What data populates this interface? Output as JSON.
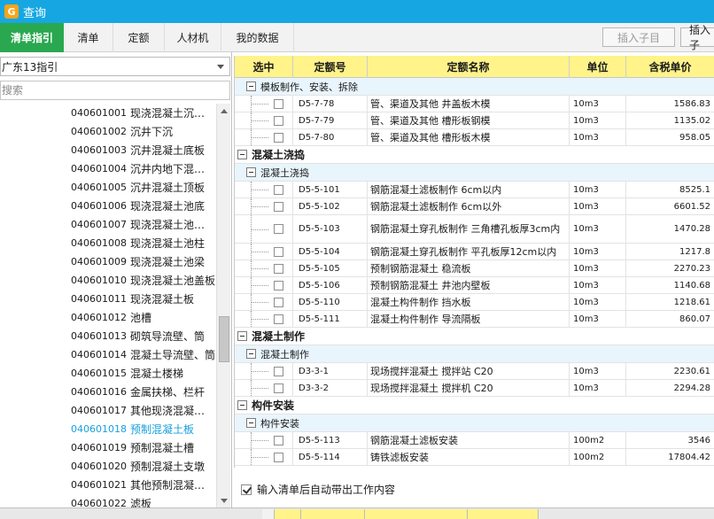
{
  "window": {
    "title": "查询"
  },
  "tabs": [
    {
      "label": "清单指引",
      "active": true
    },
    {
      "label": "清单",
      "active": false
    },
    {
      "label": "定额",
      "active": false
    },
    {
      "label": "人材机",
      "active": false
    },
    {
      "label": "我的数据",
      "active": false
    }
  ],
  "toolbar": {
    "insert_child_label": "插入子目",
    "insert_label": "插入子"
  },
  "left": {
    "combo_value": "广东13指引",
    "search_placeholder": "搜索",
    "items": [
      {
        "code": "040601001",
        "name": "现浇混凝土沉…"
      },
      {
        "code": "040601002",
        "name": "沉井下沉"
      },
      {
        "code": "040601003",
        "name": "沉井混凝土底板"
      },
      {
        "code": "040601004",
        "name": "沉井内地下混…"
      },
      {
        "code": "040601005",
        "name": "沉井混凝土顶板"
      },
      {
        "code": "040601006",
        "name": "现浇混凝土池底"
      },
      {
        "code": "040601007",
        "name": "现浇混凝土池…"
      },
      {
        "code": "040601008",
        "name": "现浇混凝土池柱"
      },
      {
        "code": "040601009",
        "name": "现浇混凝土池梁"
      },
      {
        "code": "040601010",
        "name": "现浇混凝土池盖板"
      },
      {
        "code": "040601011",
        "name": "现浇混凝土板"
      },
      {
        "code": "040601012",
        "name": "池槽"
      },
      {
        "code": "040601013",
        "name": "砌筑导流壁、筒"
      },
      {
        "code": "040601014",
        "name": "混凝土导流壁、筒"
      },
      {
        "code": "040601015",
        "name": "混凝土楼梯"
      },
      {
        "code": "040601016",
        "name": "金属扶梯、栏杆"
      },
      {
        "code": "040601017",
        "name": "其他现浇混凝…"
      },
      {
        "code": "040601018",
        "name": "预制混凝土板",
        "selected": true
      },
      {
        "code": "040601019",
        "name": "预制混凝土槽"
      },
      {
        "code": "040601020",
        "name": "预制混凝土支墩"
      },
      {
        "code": "040601021",
        "name": "其他预制混凝…"
      },
      {
        "code": "040601022",
        "name": "滤板"
      }
    ]
  },
  "grid": {
    "columns": [
      "选中",
      "定额号",
      "定额名称",
      "单位",
      "含税单价"
    ],
    "rows": [
      {
        "type": "group2",
        "label": "模板制作、安装、拆除"
      },
      {
        "type": "item",
        "code": "D5-7-78",
        "name": "管、渠道及其他 井盖板木模",
        "unit": "10m3",
        "price": "1586.83"
      },
      {
        "type": "item",
        "code": "D5-7-79",
        "name": "管、渠道及其他 槽形板钢模",
        "unit": "10m3",
        "price": "1135.02"
      },
      {
        "type": "item",
        "code": "D5-7-80",
        "name": "管、渠道及其他 槽形板木模",
        "unit": "10m3",
        "price": "958.05"
      },
      {
        "type": "group1",
        "label": "混凝土浇捣"
      },
      {
        "type": "group2",
        "label": "混凝土浇捣"
      },
      {
        "type": "item",
        "code": "D5-5-101",
        "name": "钢筋混凝土滤板制作 6cm以内",
        "unit": "10m3",
        "price": "8525.1"
      },
      {
        "type": "item",
        "code": "D5-5-102",
        "name": "钢筋混凝土滤板制作 6cm以外",
        "unit": "10m3",
        "price": "6601.52"
      },
      {
        "type": "item",
        "code": "D5-5-103",
        "name": "钢筋混凝土穿孔板制作 三角槽孔板厚3cm内",
        "unit": "10m3",
        "price": "1470.28",
        "tall": true
      },
      {
        "type": "item",
        "code": "D5-5-104",
        "name": "钢筋混凝土穿孔板制作 平孔板厚12cm以内",
        "unit": "10m3",
        "price": "1217.8"
      },
      {
        "type": "item",
        "code": "D5-5-105",
        "name": "预制钢筋混凝土 稳流板",
        "unit": "10m3",
        "price": "2270.23"
      },
      {
        "type": "item",
        "code": "D5-5-106",
        "name": "预制钢筋混凝土 井池内壁板",
        "unit": "10m3",
        "price": "1140.68"
      },
      {
        "type": "item",
        "code": "D5-5-110",
        "name": "混凝土构件制作 挡水板",
        "unit": "10m3",
        "price": "1218.61"
      },
      {
        "type": "item",
        "code": "D5-5-111",
        "name": "混凝土构件制作 导流隔板",
        "unit": "10m3",
        "price": "860.07"
      },
      {
        "type": "group1",
        "label": "混凝土制作"
      },
      {
        "type": "group2",
        "label": "混凝土制作"
      },
      {
        "type": "item",
        "code": "D3-3-1",
        "name": "现场搅拌混凝土 搅拌站 C20",
        "unit": "10m3",
        "price": "2230.61"
      },
      {
        "type": "item",
        "code": "D3-3-2",
        "name": "现场搅拌混凝土 搅拌机 C20",
        "unit": "10m3",
        "price": "2294.28"
      },
      {
        "type": "group1",
        "label": "构件安装"
      },
      {
        "type": "group2",
        "label": "构件安装"
      },
      {
        "type": "item",
        "code": "D5-5-113",
        "name": "钢筋混凝土滤板安装",
        "unit": "100m2",
        "price": "3546"
      },
      {
        "type": "item",
        "code": "D5-5-114",
        "name": "铸铁滤板安装",
        "unit": "100m2",
        "price": "17804.42"
      }
    ]
  },
  "options": {
    "auto_bring_work": "输入清单后自动带出工作内容",
    "auto_bring_work_checked": true
  }
}
